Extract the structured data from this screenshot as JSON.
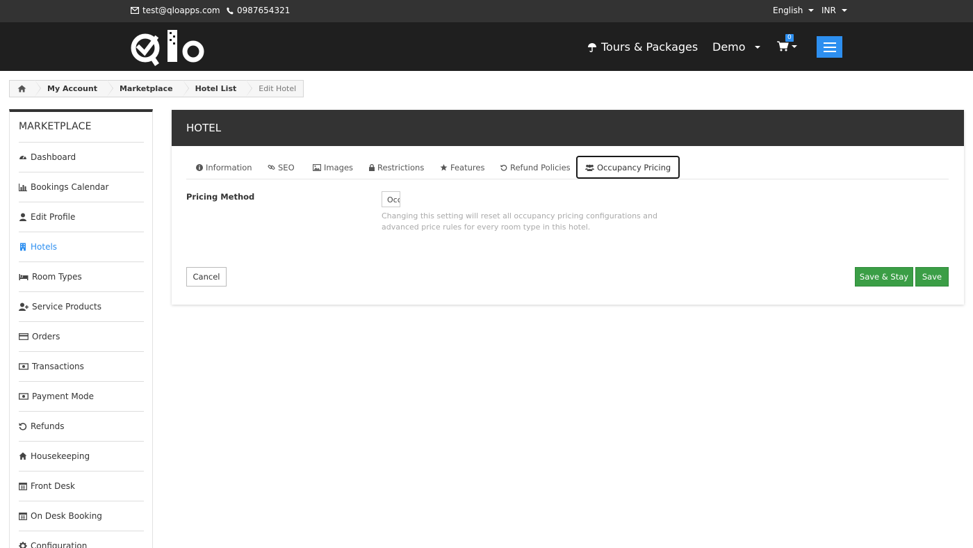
{
  "topbar": {
    "email": "test@qloapps.com",
    "phone": "0987654321",
    "language": "English",
    "currency": "INR"
  },
  "header": {
    "tours_label": "Tours & Packages",
    "demo_label": "Demo",
    "cart_count": "0"
  },
  "breadcrumb": {
    "items": [
      "My Account",
      "Marketplace",
      "Hotel List",
      "Edit Hotel"
    ]
  },
  "sidebar": {
    "title": "MARKETPLACE",
    "items": [
      {
        "label": "Dashboard",
        "icon": "dashboard-icon"
      },
      {
        "label": "Bookings Calendar",
        "icon": "bar-chart-icon"
      },
      {
        "label": "Edit Profile",
        "icon": "user-icon"
      },
      {
        "label": "Hotels",
        "icon": "building-icon",
        "active": true
      },
      {
        "label": "Room Types",
        "icon": "bed-icon"
      },
      {
        "label": "Service Products",
        "icon": "user-plus-icon"
      },
      {
        "label": "Orders",
        "icon": "credit-card-icon"
      },
      {
        "label": "Transactions",
        "icon": "money-icon"
      },
      {
        "label": "Payment Mode",
        "icon": "money-icon"
      },
      {
        "label": "Refunds",
        "icon": "undo-icon"
      },
      {
        "label": "Housekeeping",
        "icon": "home-icon"
      },
      {
        "label": "Front Desk",
        "icon": "calendar-icon"
      },
      {
        "label": "On Desk Booking",
        "icon": "calendar-icon"
      },
      {
        "label": "Configuration",
        "icon": "gear-icon"
      }
    ]
  },
  "panel": {
    "title": "HOTEL",
    "tabs": [
      {
        "label": "Information",
        "icon": "info-icon"
      },
      {
        "label": "SEO",
        "icon": "link-icon"
      },
      {
        "label": "Images",
        "icon": "image-icon"
      },
      {
        "label": "Restrictions",
        "icon": "lock-icon"
      },
      {
        "label": "Features",
        "icon": "star-icon"
      },
      {
        "label": "Refund Policies",
        "icon": "undo-icon"
      },
      {
        "label": "Occupancy Pricing",
        "icon": "users-icon",
        "active": true
      }
    ],
    "pricing_label": "Pricing Method",
    "pricing_value": "Occupancy",
    "help_text": "Changing this setting will reset all occupancy pricing configurations and advanced price rules for every room type in this hotel.",
    "cancel_label": "Cancel",
    "save_stay_label": "Save & Stay",
    "save_label": "Save"
  },
  "colors": {
    "accent": "#2d8ff0",
    "success": "#3b9e46",
    "dark": "#333333"
  }
}
